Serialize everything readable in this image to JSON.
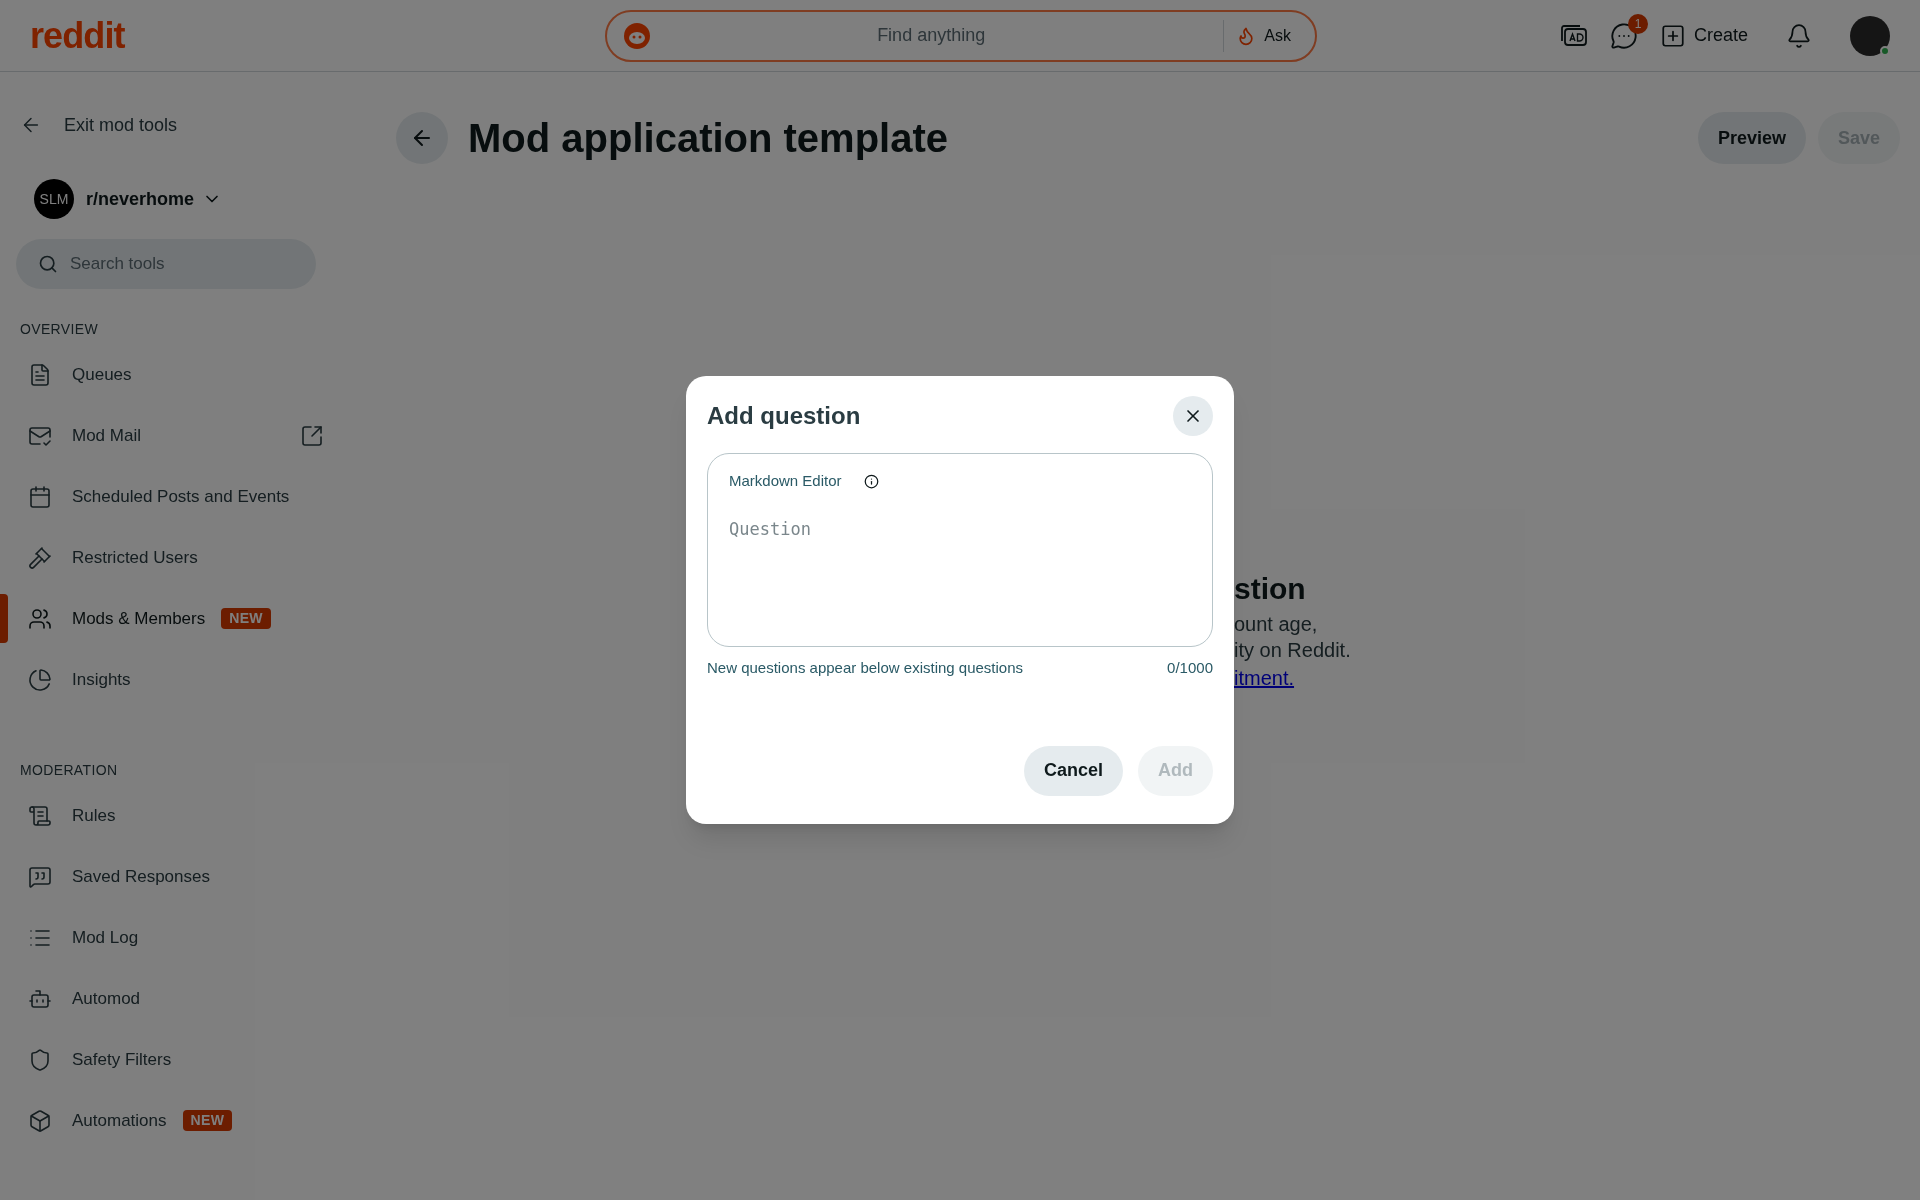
{
  "header": {
    "logo": "reddit",
    "search_placeholder": "Find anything",
    "ask": "Ask",
    "chat_badge": "1",
    "create": "Create"
  },
  "sidebar": {
    "exit": "Exit mod tools",
    "community": "r/neverhome",
    "community_avatar": "SLM",
    "search_placeholder": "Search tools",
    "sections": [
      {
        "title": "OVERVIEW",
        "items": [
          {
            "label": "Queues",
            "selected": false
          },
          {
            "label": "Mod Mail",
            "selected": false,
            "external": true
          },
          {
            "label": "Scheduled Posts and Events",
            "selected": false
          },
          {
            "label": "Restricted Users",
            "selected": false
          },
          {
            "label": "Mods & Members",
            "selected": true,
            "badge": "NEW"
          },
          {
            "label": "Insights",
            "selected": false
          }
        ]
      },
      {
        "title": "MODERATION",
        "items": [
          {
            "label": "Rules",
            "selected": false
          },
          {
            "label": "Saved Responses",
            "selected": false
          },
          {
            "label": "Mod Log",
            "selected": false
          },
          {
            "label": "Automod",
            "selected": false
          },
          {
            "label": "Safety Filters",
            "selected": false
          },
          {
            "label": "Automations",
            "selected": false,
            "badge": "NEW"
          }
        ]
      }
    ]
  },
  "page": {
    "title": "Mod application template",
    "preview": "Preview",
    "save": "Save",
    "save_disabled": true,
    "behind_heading": "stion",
    "behind_lines": [
      "ount age,",
      "ity on Reddit."
    ],
    "behind_link": "itment."
  },
  "dialog": {
    "title": "Add question",
    "editor_label": "Markdown Editor",
    "placeholder": "Question",
    "hint": "New questions appear below existing questions",
    "counter": "0/1000",
    "cancel": "Cancel",
    "add": "Add",
    "add_disabled": true
  }
}
